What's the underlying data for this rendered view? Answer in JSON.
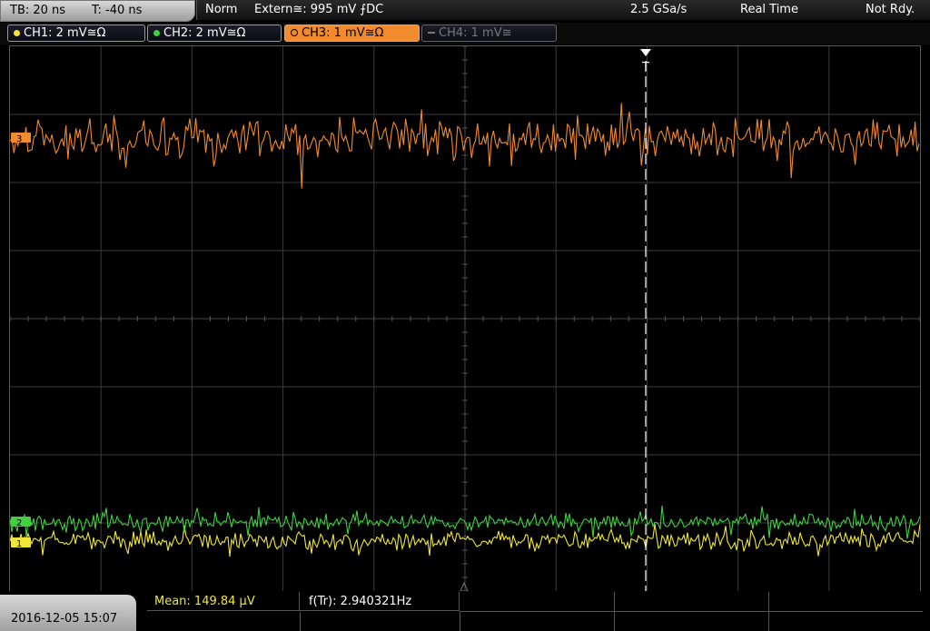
{
  "header": {
    "timebase": "TB: 20 ns",
    "trigger_offset": "T: -40 ns",
    "mode": "Norm",
    "trigger_source": "Extern≅: 995 mV ⨍DC",
    "sample_rate": "2.5 GSa/s",
    "acq_mode": "Real Time",
    "status": "Not Rdy."
  },
  "channels": [
    {
      "label": "CH1: 2 mV≅Ω",
      "color": "#f0e63a",
      "active": false
    },
    {
      "label": "CH2: 2 mV≅Ω",
      "color": "#40d040",
      "active": false
    },
    {
      "label": "CH3: 1 mV≅Ω",
      "color": "#f28a2e",
      "active": true
    },
    {
      "label": "CH4: 1 mV≅",
      "color": "#777777",
      "active": false,
      "disabled": true
    }
  ],
  "markers": {
    "trigger": "T",
    "ch3": "3",
    "ch2": "2",
    "ch1": "1"
  },
  "footer": {
    "datetime": "2016-12-05 15:07",
    "mean": "Mean: 149.84 μV",
    "ftr": "f(Tr): 2.940321Hz"
  },
  "colors": {
    "grid": "#3b3b3b",
    "ch1": "#f0e63a",
    "ch2": "#40d040",
    "ch3": "#f28a2e"
  }
}
